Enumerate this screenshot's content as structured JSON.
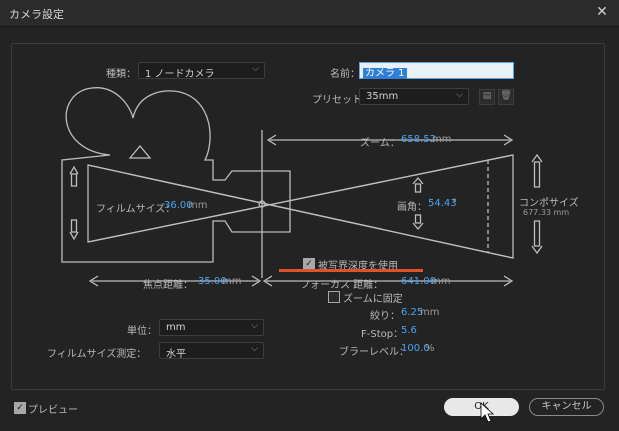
{
  "window": {
    "title": "カメラ設定",
    "close_glyph": "✕"
  },
  "camera_type": {
    "label": "種類：",
    "value": "1 ノードカメラ"
  },
  "name": {
    "label": "名前：",
    "value": "カメラ 1"
  },
  "preset": {
    "label": "プリセット：",
    "value": "35mm"
  },
  "zoom": {
    "label": "ズーム：",
    "value": "658.52",
    "unit": "mm"
  },
  "film_size": {
    "label": "フィルムサイズ：",
    "value": "36.00",
    "unit": "mm"
  },
  "angle": {
    "label": "画角：",
    "value": "54.43",
    "unit": "°"
  },
  "comp_size": {
    "label": "コンポサイズ",
    "value": "677.33 mm"
  },
  "focal_length": {
    "label": "焦点距離：",
    "value": "35.00",
    "unit": "mm"
  },
  "dof": {
    "label": "被写界深度を使用",
    "checked": true
  },
  "focus_distance": {
    "label": "フォーカス 距離：",
    "value": "641.00",
    "unit": "mm"
  },
  "lock_zoom": {
    "label": "ズームに固定",
    "checked": false
  },
  "aperture": {
    "label": "絞り：",
    "value": "6.25",
    "unit": "mm"
  },
  "fstop": {
    "label": "F-Stop：",
    "value": "5.6"
  },
  "blur": {
    "label": "ブラーレベル：",
    "value": "100.0",
    "unit": "%"
  },
  "units": {
    "label": "単位：",
    "value": "mm"
  },
  "measure_film": {
    "label": "フィルムサイズ測定：",
    "value": "水平"
  },
  "preview": {
    "label": "プレビュー",
    "checked": true
  },
  "buttons": {
    "ok": "OK",
    "cancel": "キャンセル"
  },
  "colors": {
    "accent": "#4aa3f0",
    "highlight_underline": "#e0522b",
    "bg": "#232323"
  }
}
